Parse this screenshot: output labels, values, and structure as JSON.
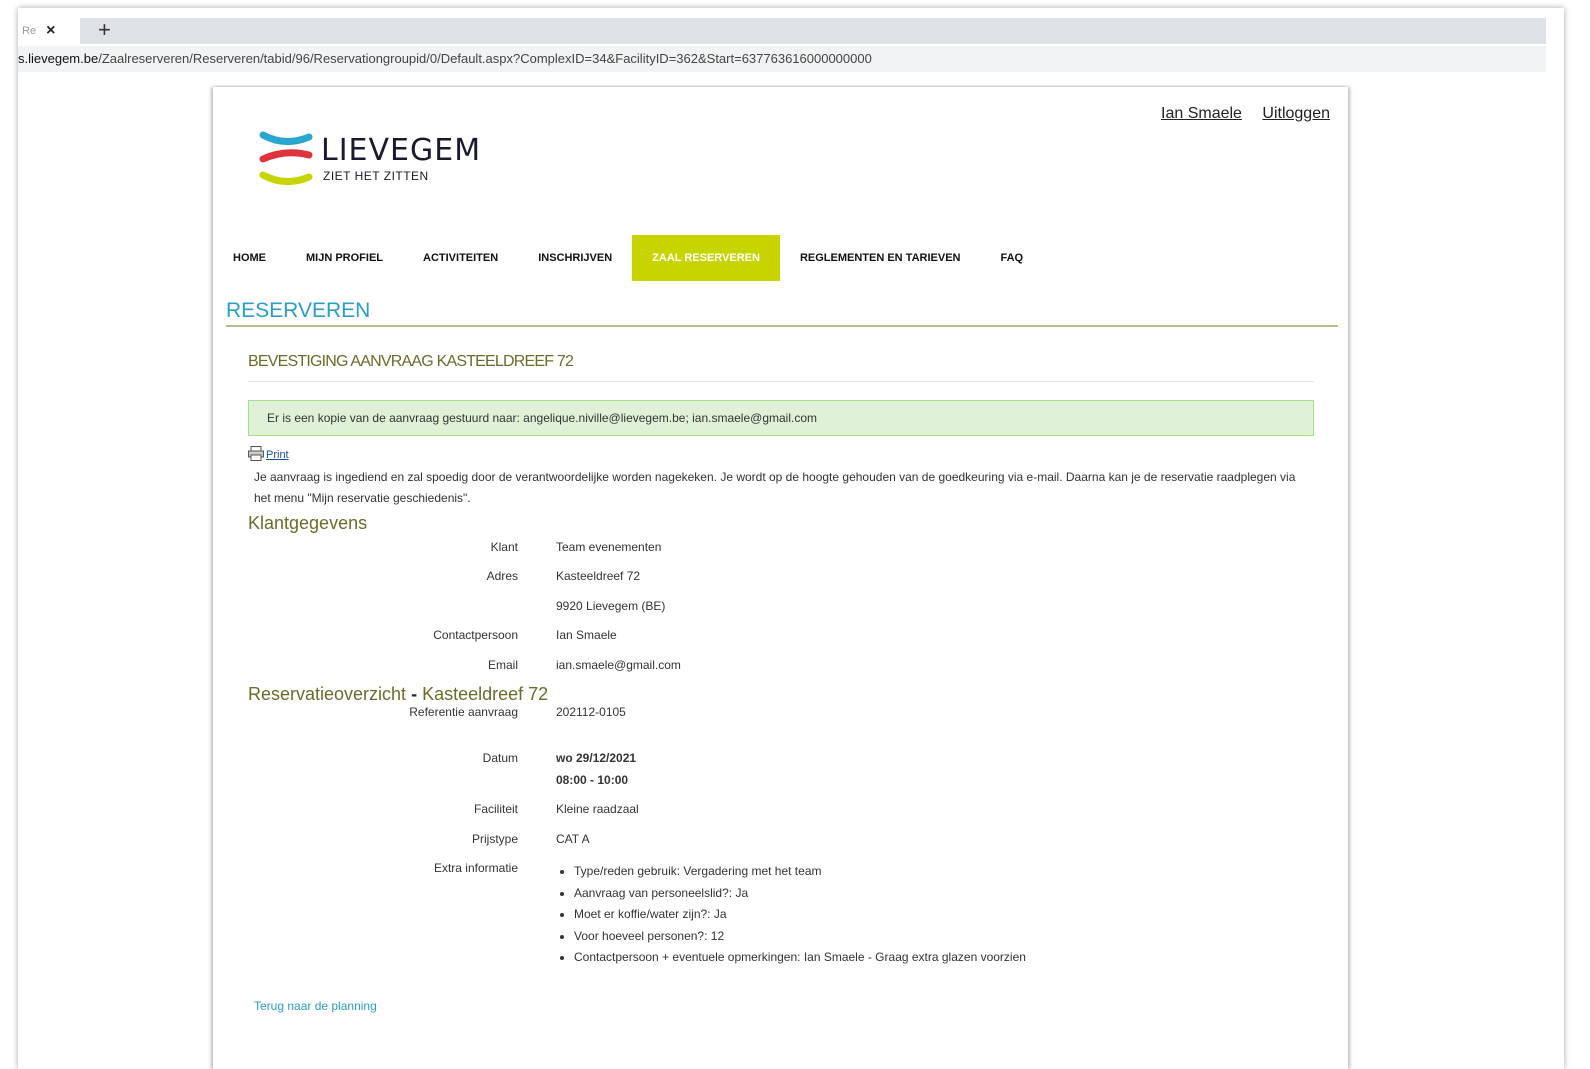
{
  "browser": {
    "tab_title": "Re",
    "tab_close": "×",
    "new_tab": "+",
    "url_host": "s.lievegem.be",
    "url_path": "/Zaalreserveren/Reserveren/tabid/96/Reservationgroupid/0/Default.aspx?ComplexID=34&FacilityID=362&Start=637763616000000000"
  },
  "header": {
    "user_name": "Ian Smaele",
    "logout": "Uitloggen",
    "logo_wordmark": "LIEVEGEM",
    "logo_tagline": "ZIET HET ZITTEN",
    "logo_colors": [
      "#2aa6cf",
      "#e0343c",
      "#c8d400"
    ]
  },
  "nav": {
    "items": [
      {
        "label": "HOME",
        "active": false
      },
      {
        "label": "MIJN PROFIEL",
        "active": false
      },
      {
        "label": "ACTIVITEITEN",
        "active": false
      },
      {
        "label": "INSCHRIJVEN",
        "active": false
      },
      {
        "label": "ZAAL RESERVEREN",
        "active": true
      },
      {
        "label": "REGLEMENTEN EN TARIEVEN",
        "active": false
      },
      {
        "label": "FAQ",
        "active": false
      }
    ]
  },
  "page": {
    "title": "RESERVEREN",
    "section_heading": "BEVESTIGING AANVRAAG  KASTEELDREEF 72",
    "alert": "Er is een kopie van de aanvraag gestuurd naar: angelique.niville@lievegem.be; ian.smaele@gmail.com",
    "print_label": "Print",
    "intro": "Je aanvraag is ingediend en zal spoedig door de verantwoordelijke worden nagekeken. Je wordt op de hoogte gehouden van de goedkeuring via e-mail. Daarna kan je de reservatie raadplegen via het menu \"Mijn reservatie geschiedenis\".",
    "customer_heading": "Klantgegevens",
    "customer": {
      "klant_label": "Klant",
      "klant_value": "Team evenementen",
      "adres_label": "Adres",
      "adres_line1": "Kasteeldreef 72",
      "adres_line2": "9920 Lievegem (BE)",
      "contact_label": "Contactpersoon",
      "contact_value": "Ian Smaele",
      "email_label": "Email",
      "email_value": "ian.smaele@gmail.com"
    },
    "overview_heading": "Reservatieoverzicht",
    "overview_dash": "-",
    "overview_location": "Kasteeldreef 72",
    "overview": {
      "ref_label": "Referentie aanvraag",
      "ref_value": "202112-0105",
      "datum_label": "Datum",
      "datum_value": "wo 29/12/2021",
      "time_value": "08:00 - 10:00",
      "faciliteit_label": "Faciliteit",
      "faciliteit_value": "Kleine raadzaal",
      "prijstype_label": "Prijstype",
      "prijstype_value": "CAT A",
      "extra_label": "Extra informatie",
      "extra": [
        "Type/reden gebruik: Vergadering met het team",
        "Aanvraag van personeelslid?: Ja",
        "Moet er koffie/water zijn?: Ja",
        "Voor hoeveel personen?: 12",
        "Contactpersoon + eventuele opmerkingen: Ian Smaele - Graag extra glazen voorzien"
      ]
    },
    "back_link": "Terug naar de planning"
  }
}
